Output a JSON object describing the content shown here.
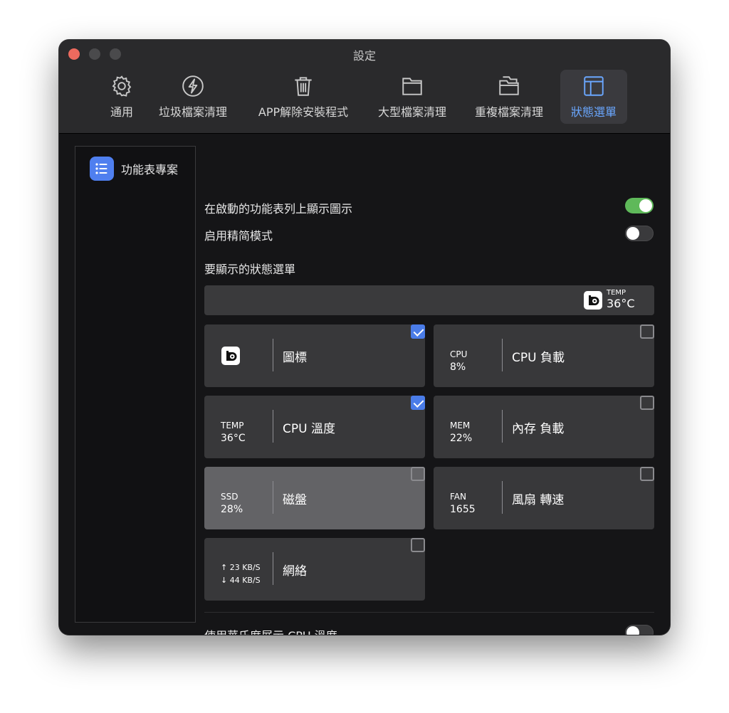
{
  "window": {
    "title": "設定"
  },
  "tabs": [
    {
      "label": "通用",
      "icon": "gear-icon"
    },
    {
      "label": "垃圾檔案清理",
      "icon": "bolt-icon"
    },
    {
      "label": "APP解除安裝程式",
      "icon": "trash-icon"
    },
    {
      "label": "大型檔案清理",
      "icon": "folder-icon"
    },
    {
      "label": "重複檔案清理",
      "icon": "duplicate-folder-icon"
    },
    {
      "label": "狀態選單",
      "icon": "layout-panel-icon",
      "active": true
    }
  ],
  "sidebar": {
    "items": [
      {
        "label": "功能表專案",
        "icon": "list-icon"
      }
    ]
  },
  "settings": {
    "show_icon": {
      "label": "在啟動的功能表列上顯示圖示",
      "on": true
    },
    "compact_mode": {
      "label": "启用精简模式",
      "on": false
    },
    "section_title": "要顯示的狀態選單",
    "fahrenheit": {
      "label": "使用華氏度展示 CPU 溫度",
      "on": false
    }
  },
  "preview": {
    "temp_label": "TEMP",
    "temp_value": "36°C"
  },
  "cards": {
    "icon": {
      "label": "圖標",
      "checked": true
    },
    "cpu": {
      "top": "CPU",
      "bottom": "8%",
      "label": "CPU 負載",
      "checked": false
    },
    "temp": {
      "top": "TEMP",
      "bottom": "36°C",
      "label": "CPU 溫度",
      "checked": true
    },
    "mem": {
      "top": "MEM",
      "bottom": "22%",
      "label": "內存 負載",
      "checked": false
    },
    "ssd": {
      "top": "SSD",
      "bottom": "28%",
      "label": "磁盤",
      "checked": false
    },
    "fan": {
      "top": "FAN",
      "bottom": "1655",
      "label": "風扇 轉速",
      "checked": false
    },
    "net": {
      "top": "↑ 23 KB/S",
      "bottom": "↓ 44 KB/S",
      "label": "網絡",
      "checked": false
    }
  },
  "colors": {
    "accent": "#4a7ce8",
    "toggle_on": "#5fb95a",
    "close": "#ed6a5e"
  }
}
